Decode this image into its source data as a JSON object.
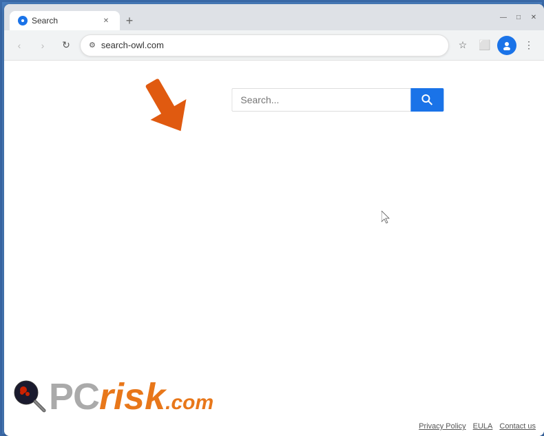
{
  "browser": {
    "tab": {
      "title": "Search",
      "favicon": "🌐"
    },
    "new_tab_label": "+",
    "window_controls": {
      "minimize": "—",
      "maximize": "□",
      "close": "✕"
    },
    "nav": {
      "back_label": "‹",
      "forward_label": "›",
      "reload_label": "↻",
      "address": "search-owl.com",
      "address_icon": "🔒",
      "bookmark_label": "☆",
      "extensions_label": "⬜",
      "profile_label": "👤",
      "menu_label": "⋮"
    }
  },
  "page": {
    "search_placeholder": "Search...",
    "search_button_icon": "🔍",
    "footer": {
      "privacy_policy": "Privacy Policy",
      "eula": "EULA",
      "contact_us": "Contact us"
    },
    "logo": {
      "pc": "PC",
      "risk": "risk",
      "dot_com": ".com"
    }
  },
  "colors": {
    "blue": "#1a73e8",
    "orange": "#e8771a",
    "arrow_orange": "#e05a10"
  }
}
